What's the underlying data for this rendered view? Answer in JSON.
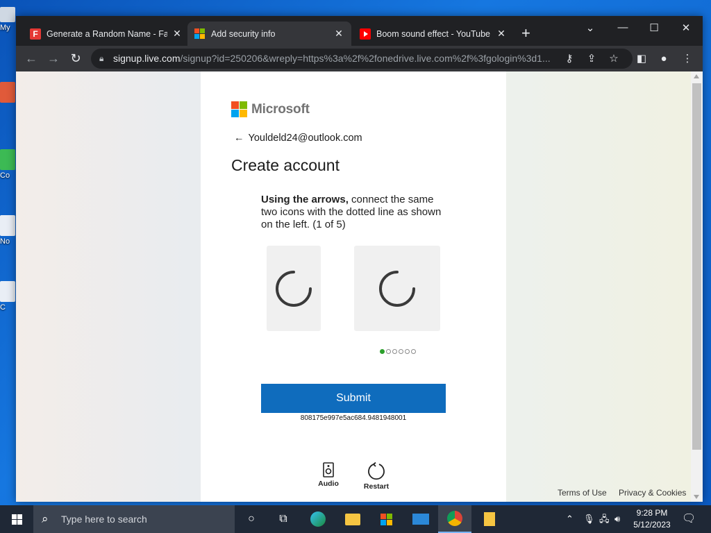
{
  "desktop": {
    "icons": [
      "My",
      "",
      "Co",
      "No",
      "C"
    ]
  },
  "browser": {
    "tabs": [
      {
        "title": "Generate a Random Name - Fake",
        "icon": "fakenamegen-icon",
        "active": false
      },
      {
        "title": "Add security info",
        "icon": "microsoft-icon",
        "active": true
      },
      {
        "title": "Boom sound effect - YouTube",
        "icon": "youtube-icon",
        "active": false
      }
    ],
    "new_tab": "+",
    "url_host": "signup.live.com",
    "url_rest": "/signup?id=250206&wreply=https%3a%2f%2fonedrive.live.com%2f%3fgologin%3d1..."
  },
  "page": {
    "logo_text": "Microsoft",
    "identity": "Youldeld24@outlook.com",
    "heading": "Create account",
    "instruction_bold": "Using the arrows,",
    "instruction_rest": " connect the same two icons with the dotted line as shown on the left. (1 of 5)",
    "progress": {
      "current": 1,
      "total": 5
    },
    "submit_label": "Submit",
    "session_id": "808175e997e5ac684.9481948001",
    "audio_label": "Audio",
    "restart_label": "Restart",
    "footer": {
      "terms": "Terms of Use",
      "privacy": "Privacy & Cookies"
    }
  },
  "taskbar": {
    "search_placeholder": "Type here to search",
    "time": "9:28 PM",
    "date": "5/12/2023"
  },
  "colors": {
    "ms_red": "#f25022",
    "ms_green": "#7fba00",
    "ms_blue": "#00a4ef",
    "ms_yellow": "#ffb900",
    "submit_blue": "#0f6cbd"
  }
}
